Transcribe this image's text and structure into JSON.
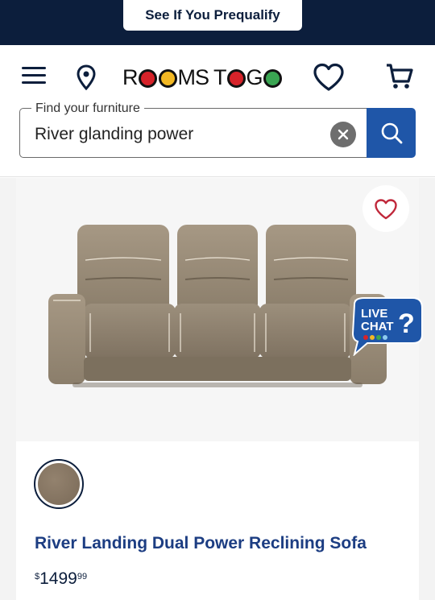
{
  "banner": {
    "prequalify_label": "See If You Prequalify"
  },
  "header": {
    "logo": {
      "part1": "R",
      "part2": "MS T",
      "part3": " G"
    },
    "search": {
      "legend": "Find your furniture",
      "value": "River glanding power"
    }
  },
  "product": {
    "name": "River Landing Dual Power Reclining Sofa",
    "price": {
      "currency": "$",
      "dollars": "1499",
      "cents": "99"
    },
    "swatch_color": "#857562"
  },
  "live_chat": {
    "line1": "LIVE",
    "line2": "CHAT"
  },
  "colors": {
    "navy": "#0c1e3c",
    "brand_blue": "#1f56a8",
    "product_blue": "#1c3d82",
    "heart_red": "#c0283b"
  },
  "icons": [
    "hamburger-menu-icon",
    "location-pin-icon",
    "heart-icon",
    "cart-icon",
    "clear-icon",
    "search-icon",
    "favorite-heart-icon",
    "live-chat-icon"
  ]
}
